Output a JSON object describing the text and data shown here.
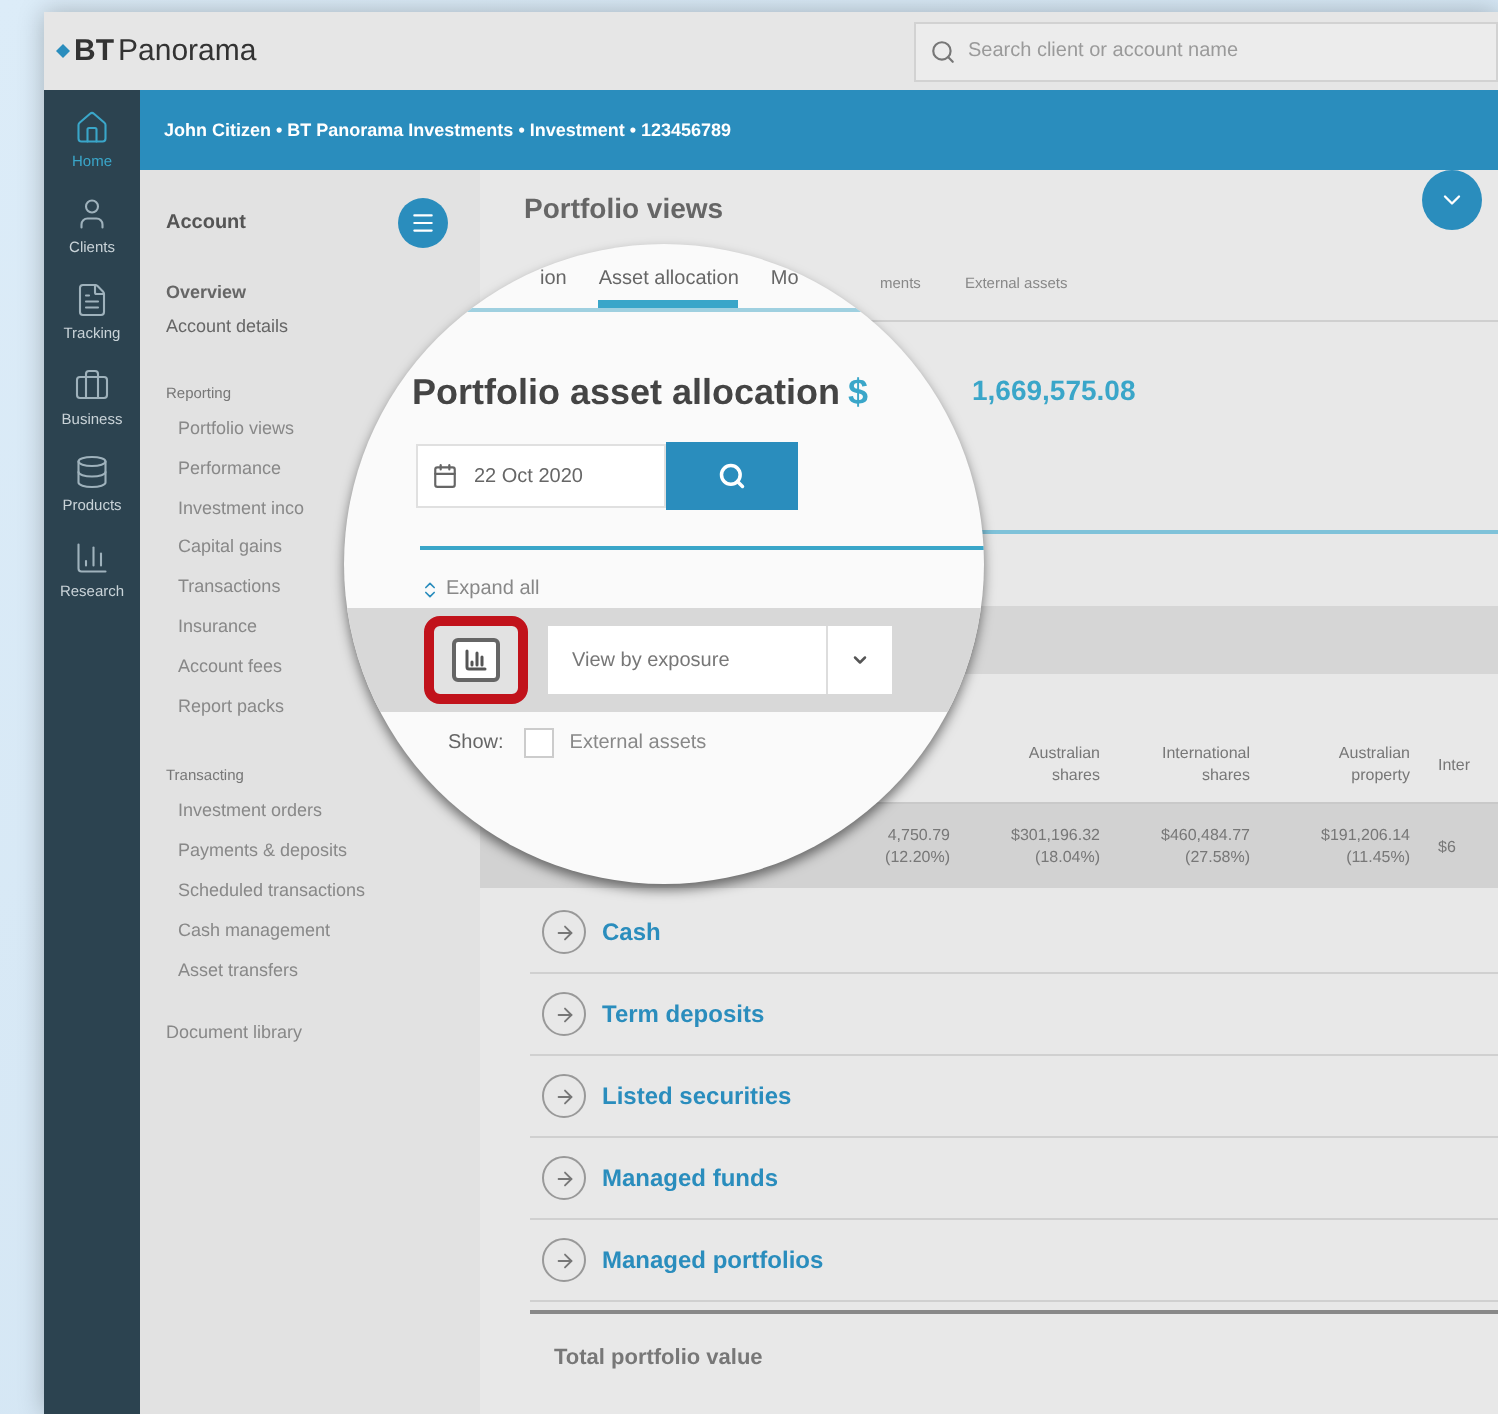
{
  "header": {
    "logo_mark": "BT",
    "logo_name": "Panorama",
    "search": {
      "placeholder": "Search client or account name"
    }
  },
  "nav": [
    {
      "label": "Home",
      "selected": true
    },
    {
      "label": "Clients",
      "selected": false
    },
    {
      "label": "Tracking",
      "selected": false
    },
    {
      "label": "Business",
      "selected": false
    },
    {
      "label": "Products",
      "selected": false
    },
    {
      "label": "Research",
      "selected": false
    }
  ],
  "breadcrumb": "John Citizen • BT Panorama Investments • Investment • 123456789",
  "sidebar": {
    "title": "Account",
    "top_items": [
      "Overview",
      "Account details"
    ],
    "sections": [
      {
        "title": "Reporting",
        "items": [
          "Portfolio views",
          "Performance",
          "Investment inco",
          "Capital gains",
          "Transactions",
          "Insurance",
          "Account fees",
          "Report packs"
        ]
      },
      {
        "title": "Transacting",
        "items": [
          "Investment orders",
          "Payments & deposits",
          "Scheduled transactions",
          "Cash management",
          "Asset transfers"
        ]
      }
    ],
    "footer_item": "Document library"
  },
  "page_title": "Portfolio views",
  "background_tabs": [
    "ments",
    "External assets"
  ],
  "background_amount": "1,669,575.08",
  "table": {
    "columns": [
      {
        "line_1": "Australian",
        "line_2": "shares"
      },
      {
        "line_1": "International",
        "line_2": "shares"
      },
      {
        "line_1": "Australian",
        "line_2": "property"
      },
      {
        "line_1": "Inter"
      }
    ],
    "values": [
      {
        "amount": "4,750.79",
        "percent": "(12.20%)"
      },
      {
        "amount": "$301,196.32",
        "percent": "(18.04%)"
      },
      {
        "amount": "$460,484.77",
        "percent": "(27.58%)"
      },
      {
        "amount": "$191,206.14",
        "percent": "(11.45%)"
      },
      {
        "amount": "$6"
      }
    ],
    "categories": [
      "Cash",
      "Term deposits",
      "Listed securities",
      "Managed funds",
      "Managed portfolios"
    ],
    "total_label": "Total portfolio value"
  },
  "magnifier": {
    "tabs": [
      {
        "label": "ion",
        "selected": false
      },
      {
        "label": "Asset allocation",
        "selected": true
      },
      {
        "label": "Mo",
        "selected": false
      }
    ],
    "heading": "Portfolio asset allocation",
    "amount": "$",
    "date": "22 Oct 2020",
    "expand_label": "Expand all",
    "chart_button_highlighted": true,
    "view_select": "View by exposure",
    "show_label": "Show:",
    "external_assets": {
      "label": "External assets",
      "checked": false
    }
  }
}
